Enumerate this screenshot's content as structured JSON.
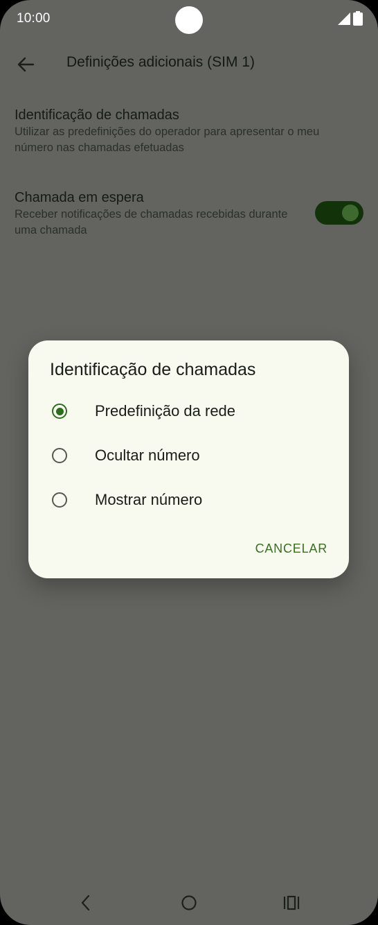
{
  "status_bar": {
    "time": "10:00"
  },
  "app_bar": {
    "title": "Definições adicionais (SIM 1)"
  },
  "settings": [
    {
      "title": "Identificação de chamadas",
      "subtitle": "Utilizar as predefinições do operador para apresentar o meu número nas chamadas efetuadas"
    },
    {
      "title": "Chamada em espera",
      "subtitle": "Receber notificações de chamadas recebidas durante uma chamada",
      "toggle_on": true
    }
  ],
  "dialog": {
    "title": "Identificação de chamadas",
    "options": [
      {
        "label": "Predefinição da rede",
        "selected": true
      },
      {
        "label": "Ocultar número",
        "selected": false
      },
      {
        "label": "Mostrar número",
        "selected": false
      }
    ],
    "cancel_label": "CANCELAR"
  },
  "colors": {
    "scrim_background": "#636460",
    "dialog_background": "#f9faef",
    "accent": "#2e6d1f",
    "toggle_track": "#12330a"
  },
  "icons": {
    "status": [
      "signal-icon",
      "battery-icon"
    ],
    "app_bar": "back-arrow-icon",
    "navigation": [
      "nav-back-icon",
      "nav-home-icon",
      "nav-recents-icon"
    ]
  }
}
